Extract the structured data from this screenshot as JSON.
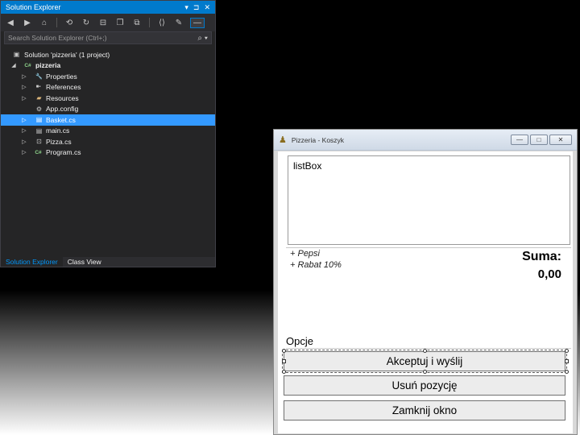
{
  "solution_explorer": {
    "title": "Solution Explorer",
    "title_controls": [
      "▾",
      "⊐",
      "✕"
    ],
    "toolbar_icons": [
      "back-icon",
      "forward-icon",
      "home-icon",
      "sync-icon",
      "refresh-icon",
      "collapse-icon",
      "copy-icon",
      "show-all-icon",
      "properties-icon",
      "preview-icon"
    ],
    "search_placeholder": "Search Solution Explorer (Ctrl+;)",
    "search_icon": "⌕",
    "tree": [
      {
        "label": "Solution 'pizzeria' (1 project)",
        "icon": "▣",
        "expander": "",
        "indent": 0
      },
      {
        "label": "pizzeria",
        "icon": "C#",
        "expander": "◢",
        "indent": 1
      },
      {
        "label": "Properties",
        "icon": "🔧",
        "expander": "▷",
        "indent": 2
      },
      {
        "label": "References",
        "icon": "■▪",
        "expander": "▷",
        "indent": 2
      },
      {
        "label": "Resources",
        "icon": "▰",
        "expander": "▷",
        "indent": 2
      },
      {
        "label": "App.config",
        "icon": "⚙",
        "expander": "",
        "indent": 2
      },
      {
        "label": "Basket.cs",
        "icon": "▤",
        "expander": "▷",
        "indent": 2,
        "selected": true
      },
      {
        "label": "main.cs",
        "icon": "▤",
        "expander": "▷",
        "indent": 2
      },
      {
        "label": "Pizza.cs",
        "icon": "⊡",
        "expander": "▷",
        "indent": 2
      },
      {
        "label": "Program.cs",
        "icon": "C#",
        "expander": "▷",
        "indent": 2
      }
    ],
    "tabs": [
      {
        "label": "Solution Explorer",
        "active": true
      },
      {
        "label": "Class View",
        "active": false
      }
    ]
  },
  "window": {
    "title": "Pizzeria - Koszyk",
    "controls": {
      "minimize": "—",
      "maximize": "□",
      "close": "✕"
    },
    "listbox_text": "listBox",
    "options": [
      "+ Pepsi",
      "+ Rabat 10%"
    ],
    "suma_label": "Suma:",
    "suma_value": "0,00",
    "group_label": "Opcje",
    "buttons": {
      "accept": "Akceptuj i wyślij",
      "remove": "Usuń pozycję",
      "close": "Zamknij okno"
    }
  },
  "colors": {
    "vs_accent": "#007acc",
    "vs_selection": "#3399ff",
    "vs_background": "#252526"
  }
}
